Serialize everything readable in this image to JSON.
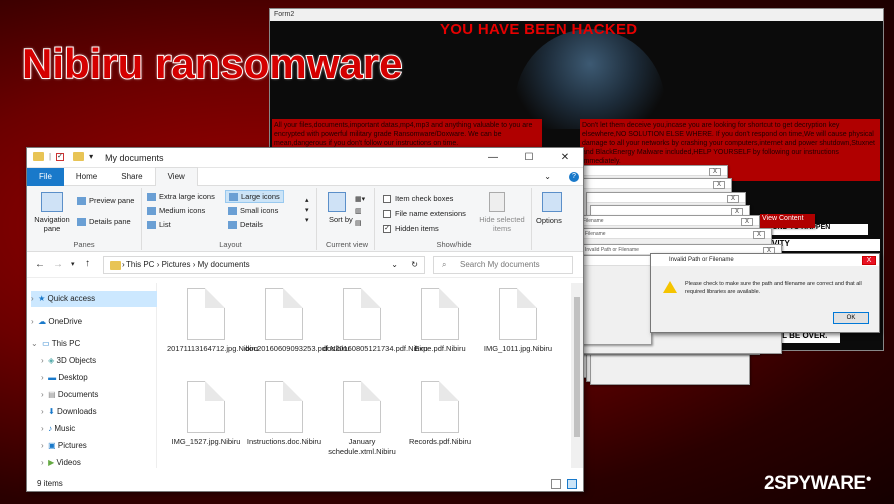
{
  "headline": "Nibiru ransomware",
  "ransom": {
    "window_title": "Form2",
    "banner": "YOU HAVE BEEN HACKED",
    "left_text": "All your files,documents,important datas,mp4,mp3 and anything valuable to you are encrypted with powerful military grade Ransomware/Doxware. We can be mean,dangerous if you don't follow our instructions on time.",
    "right_text": "Don't let them deceive you,incase you are looking for shortcut to get decryption key elsewhere,NO SOLUTION ELSE WHERE. If you don't respond on time,We will cause physical damage to all your networks by crashing your computers,internet and power shutdown,Stuxnet and BlackEnergy Malware included,HELP YOURSELF by following our instructions immediately.",
    "line1": "ROUND TO HAPPEN",
    "line2": "VITY",
    "line3": "6)YOUR REPUTATION WILL BE OVER.",
    "view_content": "View Content"
  },
  "error_dialog": {
    "title": "Invalid Path or Filename",
    "message": "Please check to make sure the path and filename are correct and that all required libraries are available.",
    "ok": "OK",
    "cascade_title": "Invalid Path or Filename",
    "cascade_short": "Filename",
    "cascade_close": "X"
  },
  "explorer": {
    "title": "My documents",
    "tabs": [
      "File",
      "Home",
      "Share",
      "View"
    ],
    "ribbon": {
      "nav_pane": "Navigation pane",
      "preview_pane": "Preview pane",
      "details_pane": "Details pane",
      "panes_label": "Panes",
      "extra_large": "Extra large icons",
      "large": "Large icons",
      "medium": "Medium icons",
      "small": "Small icons",
      "list": "List",
      "details": "Details",
      "layout_label": "Layout",
      "sort_by": "Sort by",
      "current_view_label": "Current view",
      "item_checkboxes": "Item check boxes",
      "file_name_ext": "File name extensions",
      "hidden_items": "Hidden items",
      "hide_selected": "Hide selected items",
      "options": "Options",
      "show_hide_label": "Show/hide"
    },
    "breadcrumb": [
      "This PC",
      "Pictures",
      "My documents"
    ],
    "search_placeholder": "Search My documents",
    "sidebar": [
      "Quick access",
      "OneDrive",
      "This PC",
      "3D Objects",
      "Desktop",
      "Documents",
      "Downloads",
      "Music",
      "Pictures",
      "Videos"
    ],
    "files": [
      "20171113164712.jpg.Nibiru",
      "doc20160609093253.pdf.Nibiru",
      "doc20160805121734.pdf.Nibiru",
      "Expe.pdf.Nibiru",
      "IMG_1011.jpg.Nibiru",
      "IMG_1527.jpg.Nibiru",
      "Instructions.doc.Nibiru",
      "January schedule.xtml.Nibiru",
      "Records.pdf.Nibiru"
    ],
    "status": "9 items"
  },
  "watermark": "2SPYWARE",
  "watermark_sup": "●"
}
